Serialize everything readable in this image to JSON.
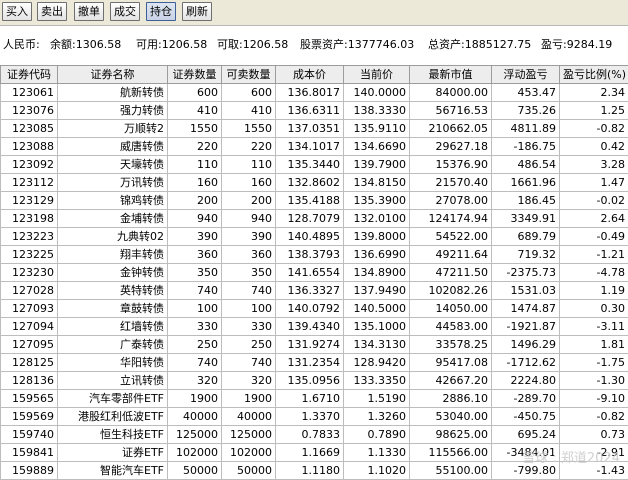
{
  "toolbar": {
    "buttons": [
      "买入",
      "卖出",
      "撤单",
      "成交",
      "持仓",
      "刷新"
    ],
    "active_index": 4
  },
  "account": {
    "currency_label": "人民币:",
    "balance": "余额:1306.58",
    "available": "可用:1206.58",
    "withdrawable": "可取:1206.58",
    "stock_assets": "股票资产:1377746.03",
    "total_assets": "总资产:1885127.75",
    "pnl": "盈亏:9284.19"
  },
  "table": {
    "columns": [
      "证券代码",
      "证券名称",
      "证券数量",
      "可卖数量",
      "成本价",
      "当前价",
      "最新市值",
      "浮动盈亏",
      "盈亏比例(%)"
    ],
    "rows": [
      [
        "123061",
        "航新转债",
        "600",
        "600",
        "136.8017",
        "140.0000",
        "84000.00",
        "453.47",
        "2.34"
      ],
      [
        "123076",
        "强力转债",
        "410",
        "410",
        "136.6311",
        "138.3330",
        "56716.53",
        "735.26",
        "1.25"
      ],
      [
        "123085",
        "万顺转2",
        "1550",
        "1550",
        "137.0351",
        "135.9110",
        "210662.05",
        "4811.89",
        "-0.82"
      ],
      [
        "123088",
        "威唐转债",
        "220",
        "220",
        "134.1017",
        "134.6690",
        "29627.18",
        "-186.75",
        "0.42"
      ],
      [
        "123092",
        "天壕转债",
        "110",
        "110",
        "135.3440",
        "139.7900",
        "15376.90",
        "486.54",
        "3.28"
      ],
      [
        "123112",
        "万讯转债",
        "160",
        "160",
        "132.8602",
        "134.8150",
        "21570.40",
        "1661.96",
        "1.47"
      ],
      [
        "123129",
        "锦鸡转债",
        "200",
        "200",
        "135.4188",
        "135.3900",
        "27078.00",
        "186.45",
        "-0.02"
      ],
      [
        "123198",
        "金埔转债",
        "940",
        "940",
        "128.7079",
        "132.0100",
        "124174.94",
        "3349.91",
        "2.64"
      ],
      [
        "123223",
        "九典转02",
        "390",
        "390",
        "140.4895",
        "139.8000",
        "54522.00",
        "689.79",
        "-0.49"
      ],
      [
        "123225",
        "翔丰转债",
        "360",
        "360",
        "138.3793",
        "136.6990",
        "49211.64",
        "719.32",
        "-1.21"
      ],
      [
        "123230",
        "金钟转债",
        "350",
        "350",
        "141.6554",
        "134.8900",
        "47211.50",
        "-2375.73",
        "-4.78"
      ],
      [
        "127028",
        "英特转债",
        "740",
        "740",
        "136.3327",
        "137.9490",
        "102082.26",
        "1531.03",
        "1.19"
      ],
      [
        "127093",
        "章鼓转债",
        "100",
        "100",
        "140.0792",
        "140.5000",
        "14050.00",
        "1474.87",
        "0.30"
      ],
      [
        "127094",
        "红墙转债",
        "330",
        "330",
        "139.4340",
        "135.1000",
        "44583.00",
        "-1921.87",
        "-3.11"
      ],
      [
        "127095",
        "广泰转债",
        "250",
        "250",
        "131.9274",
        "134.3130",
        "33578.25",
        "1496.29",
        "1.81"
      ],
      [
        "128125",
        "华阳转债",
        "740",
        "740",
        "131.2354",
        "128.9420",
        "95417.08",
        "-1712.62",
        "-1.75"
      ],
      [
        "128136",
        "立讯转债",
        "320",
        "320",
        "135.0956",
        "133.3350",
        "42667.20",
        "2224.80",
        "-1.30"
      ],
      [
        "159565",
        "汽车零部件ETF",
        "1900",
        "1900",
        "1.6710",
        "1.5190",
        "2886.10",
        "-289.70",
        "-9.10"
      ],
      [
        "159569",
        "港股红利低波ETF",
        "40000",
        "40000",
        "1.3370",
        "1.3260",
        "53040.00",
        "-450.75",
        "-0.82"
      ],
      [
        "159740",
        "恒生科技ETF",
        "125000",
        "125000",
        "0.7833",
        "0.7890",
        "98625.00",
        "695.24",
        "0.73"
      ],
      [
        "159841",
        "证券ETF",
        "102000",
        "102000",
        "1.1669",
        "1.1330",
        "115566.00",
        "-3484.01",
        "-2.91"
      ],
      [
        "159889",
        "智能汽车ETF",
        "50000",
        "50000",
        "1.1180",
        "1.1020",
        "55100.00",
        "-799.80",
        "-1.43"
      ]
    ]
  },
  "watermark": "雪球 : 郑道2024"
}
